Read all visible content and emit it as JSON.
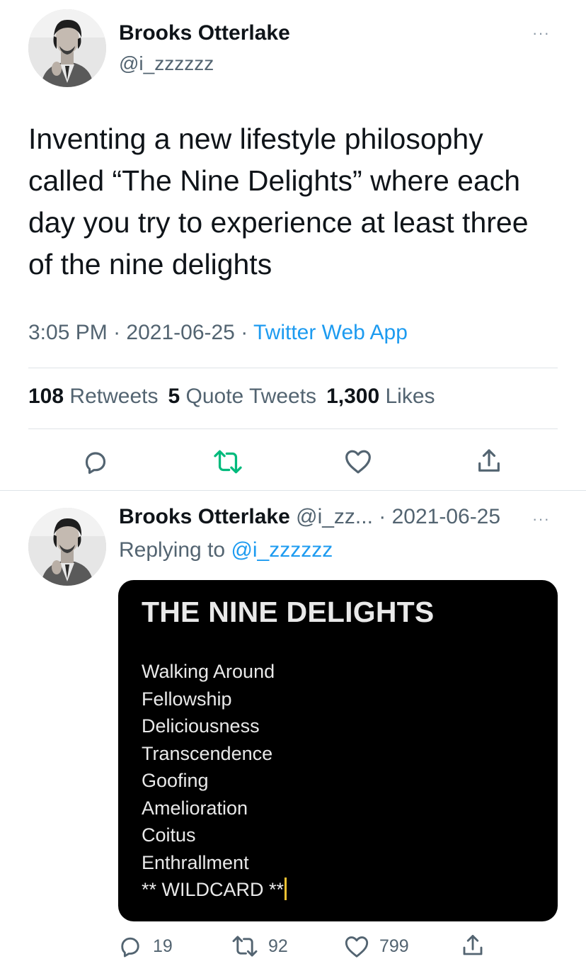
{
  "main_tweet": {
    "author_name": "Brooks Otterlake",
    "author_handle": "@i_zzzzzz",
    "text": "Inventing a new lifestyle philosophy called “The Nine Delights” where each day you try to experience at least three of the nine delights",
    "time": "3:05 PM",
    "separator": " · ",
    "date": "2021-06-25",
    "source": "Twitter Web App",
    "stats": {
      "retweets_count": "108",
      "retweets_label": "Retweets",
      "quotes_count": "5",
      "quotes_label": "Quote Tweets",
      "likes_count": "1,300",
      "likes_label": "Likes"
    }
  },
  "reply_tweet": {
    "author_name": "Brooks Otterlake",
    "author_handle": "@i_zz...",
    "separator": " · ",
    "date": "2021-06-25",
    "replying_prefix": "Replying to ",
    "replying_handle": "@i_zzzzzz",
    "image": {
      "title": "THE NINE DELIGHTS",
      "items": [
        "Walking Around",
        "Fellowship",
        "Deliciousness",
        "Transcendence",
        "Goofing",
        "Amelioration",
        "Coitus",
        "Enthrallment",
        "** WILDCARD **"
      ]
    },
    "actions": {
      "replies": "19",
      "retweets": "92",
      "likes": "799"
    }
  },
  "icons": {
    "more": "more-icon",
    "reply": "reply-icon",
    "retweet": "retweet-icon",
    "like": "heart-icon",
    "share": "share-icon"
  },
  "more_glyph": "···",
  "colors": {
    "link": "#1d9bf0",
    "retweet_active": "#00ba7c",
    "secondary_text": "#536471",
    "cursor": "#f1c232"
  }
}
